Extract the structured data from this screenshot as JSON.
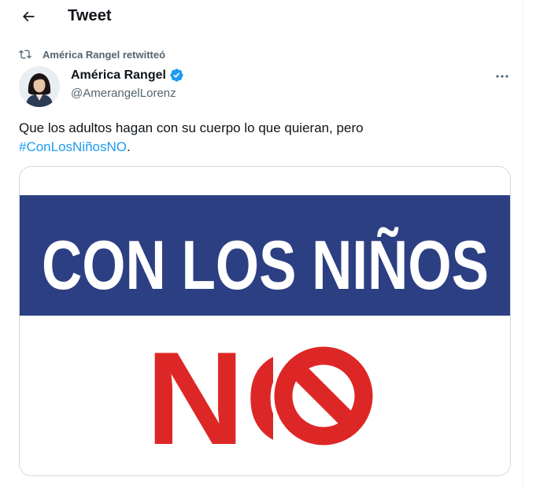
{
  "header": {
    "back_icon": "arrow-left-icon",
    "title": "Tweet"
  },
  "retweet": {
    "icon": "retweet-icon",
    "text": "América Rangel retwitteó"
  },
  "author": {
    "display_name": "América Rangel",
    "handle": "@AmerangelLorenz",
    "verified": true,
    "verified_color": "#1d9bf0"
  },
  "tweet": {
    "text_before": "Que los adultos hagan con su cuerpo lo que quieran, pero",
    "hashtag": "#ConLosNiñosNO",
    "text_after": "."
  },
  "media": {
    "banner_text": "CON LOS NIÑOS",
    "big_text": "NO",
    "banner_color": "#2d3f83",
    "accent_color": "#dd2726"
  },
  "colors": {
    "link": "#1d9bf0",
    "secondary_text": "#536471",
    "border": "#cfd9de"
  }
}
